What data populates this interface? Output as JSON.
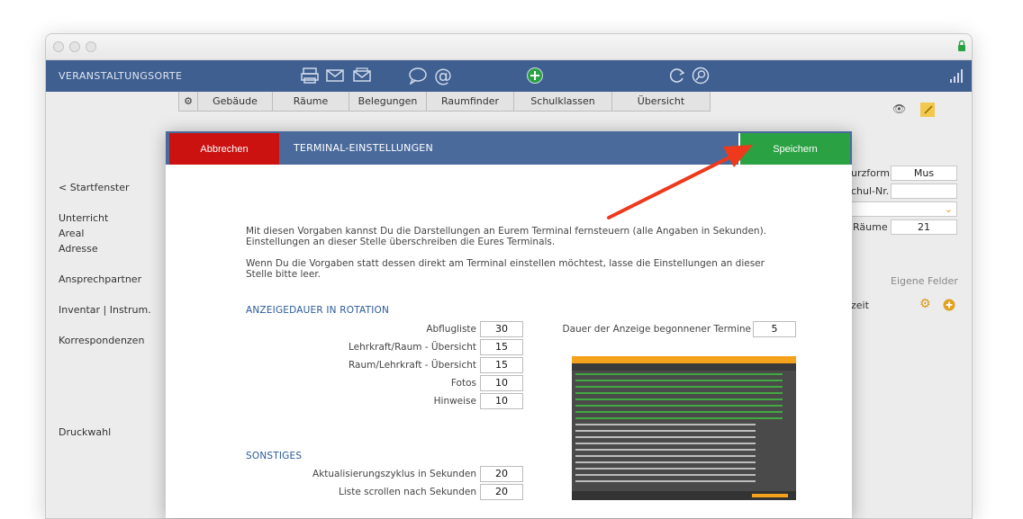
{
  "app": {
    "title": "VERANSTALTUNGSORTE",
    "toolbar_icons": [
      "printer-icon",
      "mail-icon",
      "mail-open-icon",
      "sms-icon",
      "at-icon",
      "add-icon",
      "refresh-icon",
      "search-icon"
    ],
    "signal_icon": "signal-icon"
  },
  "tabs": [
    {
      "label": "Gebäude"
    },
    {
      "label": "Räume"
    },
    {
      "label": "Belegungen"
    },
    {
      "label": "Raumfinder"
    },
    {
      "label": "Schulklassen"
    },
    {
      "label": "Übersicht"
    }
  ],
  "sidebar": {
    "start": "< Startfenster",
    "items": [
      "Unterricht",
      "Areal",
      "Adresse",
      "Ansprechpartner",
      "Inventar | Instrum.",
      "Korrespondenzen",
      "Druckwahl"
    ]
  },
  "background_fields": {
    "kurzform_label": "urzform",
    "kurzform_value": "Mus",
    "schulnr_label": "chul-Nr.",
    "raeume_label": "Räume",
    "raeume_value": "21",
    "eigene_felder": "Eigene Felder",
    "zeit_label": "zeit"
  },
  "modal": {
    "cancel_label": "Abbrechen",
    "title": "TERMINAL-EINSTELLUNGEN",
    "save_label": "Speichern",
    "intro_1": "Mit diesen Vorgaben kannst Du die Darstellungen an Eurem Terminal fernsteuern (alle Angaben in Sekunden).",
    "intro_2": "Einstellungen an dieser Stelle überschreiben die Eures Terminals.",
    "intro_3": "Wenn Du die Vorgaben statt dessen direkt am Terminal einstellen möchtest, lasse die Einstellungen an dieser",
    "intro_4": "Stelle bitte leer.",
    "section_rotation": "ANZEIGEDAUER IN ROTATION",
    "rotation": [
      {
        "label": "Abflugliste",
        "value": "30"
      },
      {
        "label": "Lehrkraft/Raum - Übersicht",
        "value": "15"
      },
      {
        "label": "Raum/Lehrkraft - Übersicht",
        "value": "15"
      },
      {
        "label": "Fotos",
        "value": "10"
      },
      {
        "label": "Hinweise",
        "value": "10"
      }
    ],
    "started_label": "Dauer der Anzeige begonnener Termine",
    "started_value": "5",
    "section_misc": "SONSTIGES",
    "misc": [
      {
        "label": "Aktualisierungszyklus in Sekunden",
        "value": "20"
      },
      {
        "label": "Liste scrollen nach Sekunden",
        "value": "20"
      }
    ]
  },
  "colors": {
    "topbar": "#3f5f91",
    "modal_header": "#4a6a9c",
    "cancel": "#cc1111",
    "save": "#2aa243",
    "section": "#2b5a9a",
    "arrow": "#ee3a1c"
  }
}
